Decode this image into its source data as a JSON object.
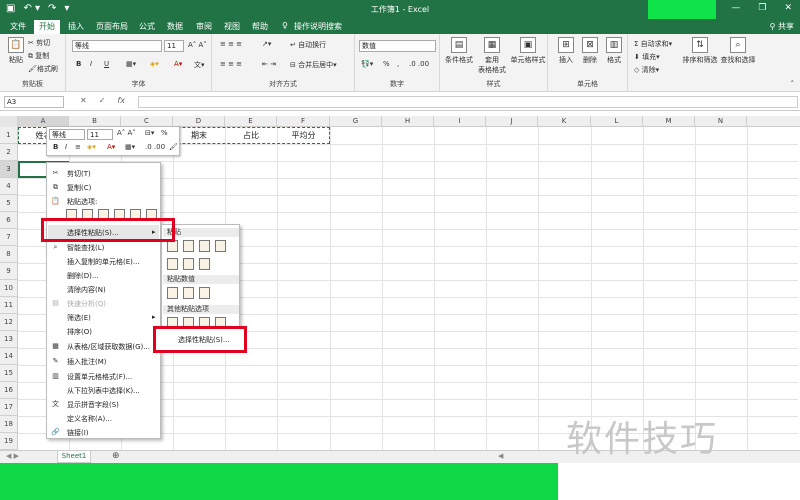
{
  "app": {
    "title": "工作簿1 - Excel",
    "share": "共享",
    "qat": {
      "save_icon": "save-icon",
      "undo_icon": "undo-icon",
      "redo_icon": "redo-icon"
    },
    "window_buttons": [
      "ribbon-options-icon",
      "minimize-icon",
      "restore-icon",
      "close-icon"
    ]
  },
  "tabs": [
    "文件",
    "开始",
    "插入",
    "页面布局",
    "公式",
    "数据",
    "审阅",
    "视图",
    "帮助",
    "操作说明搜索"
  ],
  "active_tab": "开始",
  "ribbon": {
    "clipboard": {
      "label": "剪贴板",
      "paste": "粘贴",
      "cut": "剪切",
      "copy": "复制",
      "format_painter": "格式刷"
    },
    "font": {
      "label": "字体",
      "font_name": "等线",
      "font_size": "11",
      "bold": "B",
      "italic": "I",
      "underline": "U"
    },
    "alignment": {
      "label": "对齐方式",
      "wrap": "自动换行",
      "merge": "合并后居中"
    },
    "number": {
      "label": "数字",
      "format": "数值",
      "percent": "%",
      "comma": ","
    },
    "styles": {
      "label": "样式",
      "conditional": "条件格式",
      "table": "套用\n表格格式",
      "cell_styles": "单元格样式"
    },
    "cells": {
      "label": "单元格",
      "insert": "插入",
      "delete": "删除",
      "format": "格式"
    },
    "editing": {
      "autosum": "自动求和",
      "fill": "填充",
      "clear": "清除",
      "sort": "排序和筛选",
      "find": "查找和选择"
    }
  },
  "formula_bar": {
    "name_box": "A3",
    "fx": "fx",
    "value": ""
  },
  "columns": [
    "A",
    "B",
    "C",
    "D",
    "E",
    "F",
    "G",
    "H",
    "I",
    "J",
    "K",
    "L",
    "M",
    "N"
  ],
  "rows": [
    "1",
    "2",
    "3",
    "4",
    "5",
    "6",
    "7",
    "8",
    "9",
    "10",
    "11",
    "12",
    "13",
    "14",
    "15",
    "16",
    "17",
    "18",
    "19"
  ],
  "cells": {
    "a1": "姓名",
    "d1": "期末",
    "e1": "占比",
    "f1": "平均分"
  },
  "mini_toolbar": {
    "font": "等线",
    "size": "11",
    "bold": "B",
    "italic": "I",
    "percent": "%"
  },
  "context_menu": {
    "items": [
      "剪切(T)",
      "复制(C)",
      "粘贴选项:",
      "选择性粘贴(S)...",
      "智能查找(L)",
      "插入复制的单元格(E)...",
      "删除(D)...",
      "清除内容(N)",
      "快速分析(Q)",
      "筛选(E)",
      "排序(O)",
      "从表格/区域获取数据(G)...",
      "插入批注(M)",
      "设置单元格格式(F)...",
      "从下拉列表中选择(K)...",
      "显示拼音字段(S)",
      "定义名称(A)...",
      "链接(I)"
    ]
  },
  "submenu": {
    "header_paste": "粘贴",
    "header_values": "粘贴数值",
    "header_other": "其他粘贴选项",
    "paste_special": "选择性粘贴(S)..."
  },
  "sheets": {
    "active": "Sheet1"
  },
  "watermark": "软件技巧",
  "colors": {
    "excel_green": "#217346",
    "highlight_red": "#e00020",
    "overlay_green": "#10d947"
  }
}
